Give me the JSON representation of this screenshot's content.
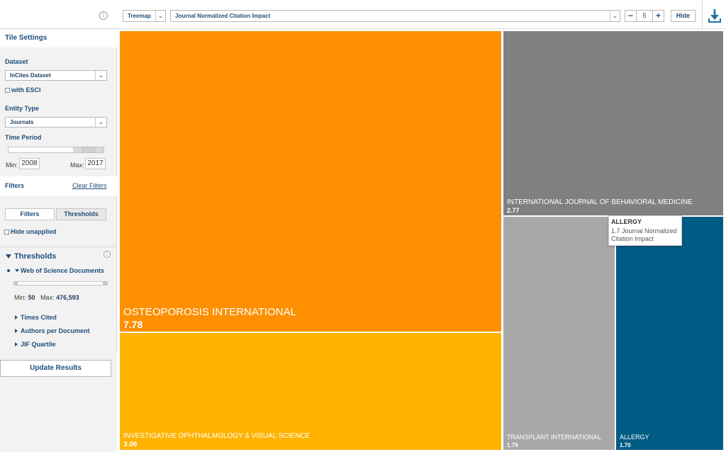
{
  "sidebar": {
    "tile_settings": "Tile Settings",
    "dataset": {
      "label": "Dataset",
      "value": "InCites Dataset",
      "with_esci": "with ESCI"
    },
    "entity_type": {
      "label": "Entity Type",
      "value": "Journals"
    },
    "time_period": {
      "label": "Time Period",
      "min_label": "Min:",
      "min_value": "2008",
      "max_label": "Max:",
      "max_value": "2017"
    },
    "filters": {
      "label": "Filters",
      "clear": "Clear Filters",
      "tab_filters": "Filters",
      "tab_thresholds": "Thresholds",
      "hide_unapplied": "Hide unapplied"
    },
    "thresholds": {
      "title": "Thresholds",
      "wos": {
        "label": "Web of Science Documents",
        "min_label": "Min:",
        "min_value": "50",
        "max_label": "Max:",
        "max_value": "476,593"
      },
      "items": [
        "Times Cited",
        "Authors per Document",
        "JIF Quartile"
      ]
    },
    "update_button": "Update Results"
  },
  "toolbar": {
    "visualization": "Treemap",
    "indicator": "Journal Normalized Citation Impact",
    "minus": "−",
    "count": "5",
    "plus": "+",
    "hide": "Hide"
  },
  "colors": {
    "osteoporosis": "#fd8f00",
    "ophthalmology": "#ffb300",
    "behavioral": "#808080",
    "transplant": "#a8a8a8",
    "allergy": "#005b85"
  },
  "icons": [
    "info-icon",
    "chevron-down-icon",
    "download-icon",
    "triangle-down-icon",
    "triangle-right-icon"
  ],
  "chart_data": {
    "type": "treemap",
    "metric": "Journal Normalized Citation Impact",
    "items": [
      {
        "name": "OSTEOPOROSIS INTERNATIONAL",
        "value": 7.78
      },
      {
        "name": "INVESTIGATIVE OPHTHALMOLOGY & VISUAL SCIENCE",
        "value": 3.06
      },
      {
        "name": "INTERNATIONAL JOURNAL OF BEHAVIORAL MEDICINE",
        "value": 2.77
      },
      {
        "name": "TRANSPLANT INTERNATIONAL",
        "value": 1.79
      },
      {
        "name": "ALLERGY",
        "value": 1.7
      }
    ],
    "value_labels": [
      "7.78",
      "3.06",
      "2.77",
      "1.79",
      "1.70"
    ],
    "tooltip": {
      "title": "ALLERGY",
      "text": "1.7 Journal Normalized Citation Impact"
    }
  }
}
